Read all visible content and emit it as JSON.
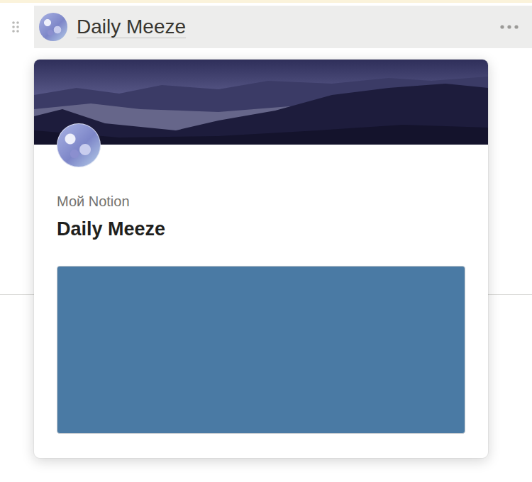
{
  "block": {
    "title": "Daily Meeze",
    "highlighted": true
  },
  "preview_card": {
    "workspace": "Мой Notion",
    "title": "Daily Meeze"
  }
}
